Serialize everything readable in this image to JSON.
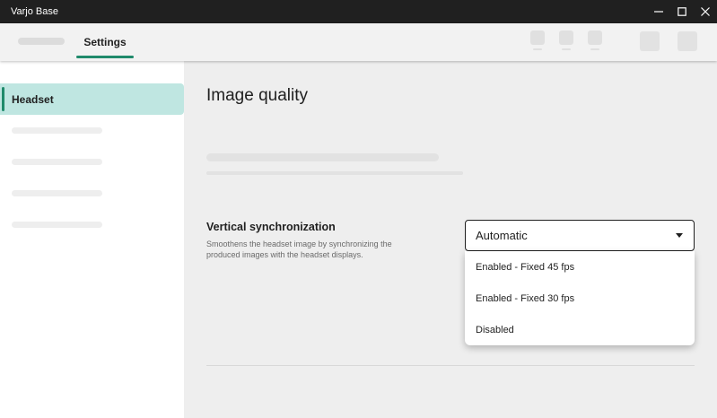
{
  "window": {
    "title": "Varjo Base"
  },
  "nav": {
    "active_tab": "Settings"
  },
  "sidebar": {
    "active_item": "Headset"
  },
  "main": {
    "page_title": "Image quality",
    "setting": {
      "title": "Vertical synchronization",
      "description": "Smoothens the headset image by synchronizing the produced images with the headset displays.",
      "selected_value": "Automatic",
      "options": [
        "Enabled - Fixed 45 fps",
        "Enabled - Fixed 30 fps",
        "Disabled"
      ]
    }
  },
  "colors": {
    "accent": "#1f8a6b",
    "active_item_bg": "#bfe6e1",
    "titlebar_bg": "#202020"
  },
  "icons": {
    "minimize": "minimize-icon",
    "maximize": "maximize-icon",
    "close": "close-icon",
    "caret": "caret-down-icon"
  }
}
